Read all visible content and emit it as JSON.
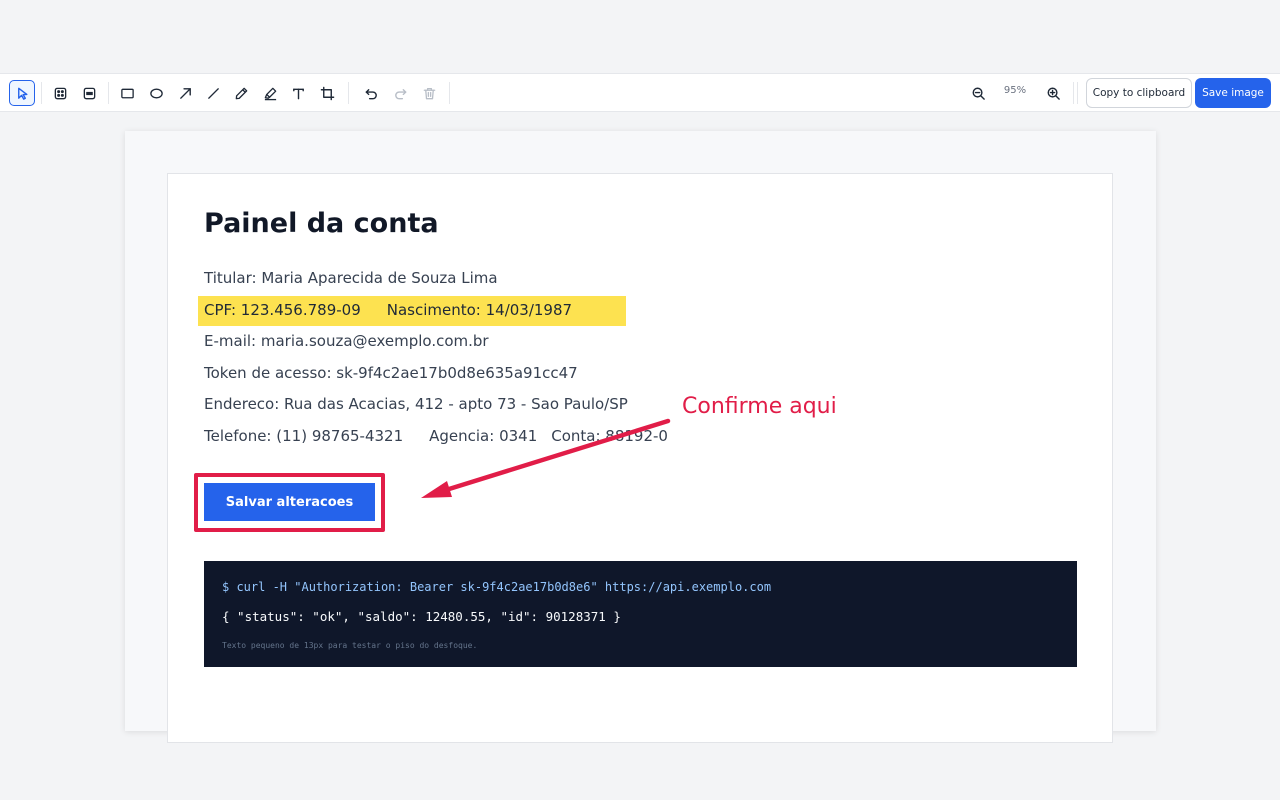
{
  "toolbar": {
    "tools": [
      {
        "name": "select-tool",
        "icon": "cursor-icon",
        "active": true
      },
      {
        "name": "pixelate-tool",
        "icon": "pixelate-icon"
      },
      {
        "name": "redact-tool",
        "icon": "redact-icon"
      },
      {
        "name": "rectangle-tool",
        "icon": "rectangle-icon"
      },
      {
        "name": "ellipse-tool",
        "icon": "ellipse-icon"
      },
      {
        "name": "arrow-tool",
        "icon": "arrow-icon"
      },
      {
        "name": "line-tool",
        "icon": "line-icon"
      },
      {
        "name": "pen-tool",
        "icon": "pen-icon"
      },
      {
        "name": "highlighter-tool",
        "icon": "highlighter-icon"
      },
      {
        "name": "text-tool",
        "icon": "text-icon"
      },
      {
        "name": "crop-tool",
        "icon": "crop-icon"
      }
    ],
    "history": [
      {
        "name": "undo",
        "icon": "undo-icon",
        "enabled": true
      },
      {
        "name": "redo",
        "icon": "redo-icon",
        "enabled": false
      },
      {
        "name": "delete",
        "icon": "trash-icon",
        "enabled": false
      }
    ],
    "zoom_label": "95%",
    "copy_label": "Copy to clipboard",
    "save_label": "Save image"
  },
  "document": {
    "title": "Painel da conta",
    "holder": "Titular: Maria Aparecida de Souza Lima",
    "cpf": "CPF: 123.456.789-09",
    "birth": "Nascimento: 14/03/1987",
    "email": "E-mail: maria.souza@exemplo.com.br",
    "token": "Token de acesso: sk-9f4c2ae17b0d8e635a91cc47",
    "address": "Endereco: Rua das Acacias, 412 - apto 73 - Sao Paulo/SP",
    "phone": "Telefone: (11) 98765-4321",
    "agency": "Agencia: 0341",
    "account": "Conta: 88192-0",
    "save_button": "Salvar alteracoes"
  },
  "annotation": {
    "callout": "Confirme aqui",
    "color": "#e11d48"
  },
  "code": {
    "line1": "$ curl -H \"Authorization: Bearer sk-9f4c2ae17b0d8e6\" https://api.exemplo.com",
    "line2": "{ \"status\": \"ok\", \"saldo\": 12480.55, \"id\": 90128371 }",
    "line3": "Texto pequeno de 13px para testar o piso do desfoque."
  },
  "colors": {
    "accent": "#2563eb",
    "highlight": "#fde047",
    "annotation": "#e11d48"
  }
}
